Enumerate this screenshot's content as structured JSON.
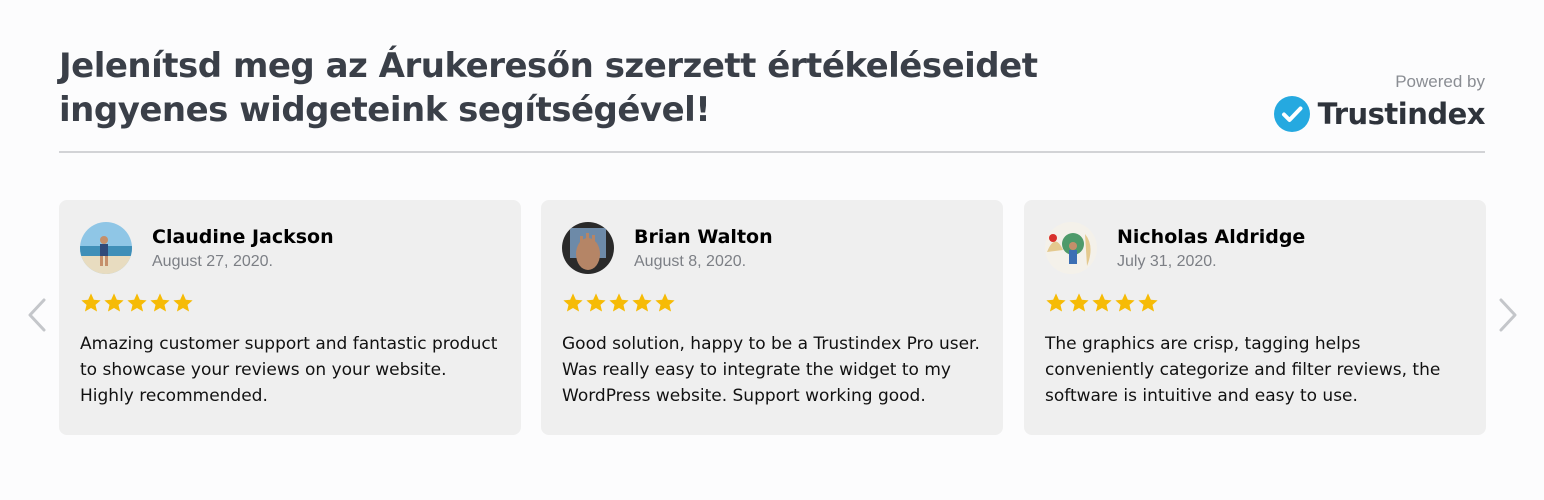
{
  "header": {
    "title_line1": "Jelenítsd meg az Árukeresőn szerzett értékeléseidet",
    "title_line2": "ingyenes widgeteink segítségével!",
    "powered_by": "Powered by",
    "brand_name": "Trustindex",
    "brand_icon": "check-circle-icon",
    "brand_color": "#25a9e0"
  },
  "carousel": {
    "prev_icon": "chevron-left-icon",
    "next_icon": "chevron-right-icon",
    "star_color": "#f6bb06",
    "reviews": [
      {
        "name": "Claudine Jackson",
        "date": "August 27, 2020.",
        "rating": 5,
        "text": "Amazing customer support and fantastic product to showcase your reviews on your website. Highly recommended."
      },
      {
        "name": "Brian Walton",
        "date": "August 8, 2020.",
        "rating": 5,
        "text": "Good solution, happy to be a Trustindex Pro user. Was really easy to integrate the widget to my WordPress website. Support working good."
      },
      {
        "name": "Nicholas Aldridge",
        "date": "July 31, 2020.",
        "rating": 5,
        "text": "The graphics are crisp, tagging helps conveniently categorize and filter reviews, the software is intuitive and easy to use."
      }
    ]
  }
}
